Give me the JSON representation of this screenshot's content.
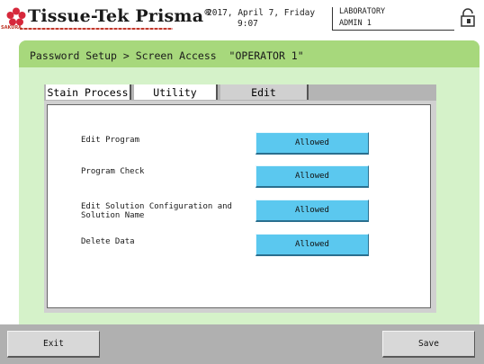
{
  "header": {
    "brand": "Tissue-Tek Prisma",
    "brand_mark": "®",
    "sub_brand": "SAKURA",
    "date": "2017, April 7, Friday",
    "time": "9:07",
    "location": "LABORATORY",
    "user": "ADMIN 1"
  },
  "breadcrumb": "Password Setup > Screen Access  \"OPERATOR 1\"",
  "tabs": [
    {
      "label": "Stain Process"
    },
    {
      "label": "Utility"
    },
    {
      "label": "Edit",
      "selected": true
    }
  ],
  "permissions": [
    {
      "label": "Edit Program",
      "value": "Allowed"
    },
    {
      "label": "Program Check",
      "value": "Allowed"
    },
    {
      "label": "Edit Solution Configuration and Solution Name",
      "label_line1": "Edit Solution Configuration and",
      "label_line2": "Solution Name",
      "value": "Allowed"
    },
    {
      "label": "Delete Data",
      "value": "Allowed"
    }
  ],
  "footer": {
    "exit_label": "Exit",
    "save_label": "Save"
  },
  "colors": {
    "panel_title_bar": "#a7d87c",
    "panel_bg": "#d5f2c9",
    "allowed_button": "#5bc8ef",
    "footer_bg": "#b0b0b0"
  }
}
